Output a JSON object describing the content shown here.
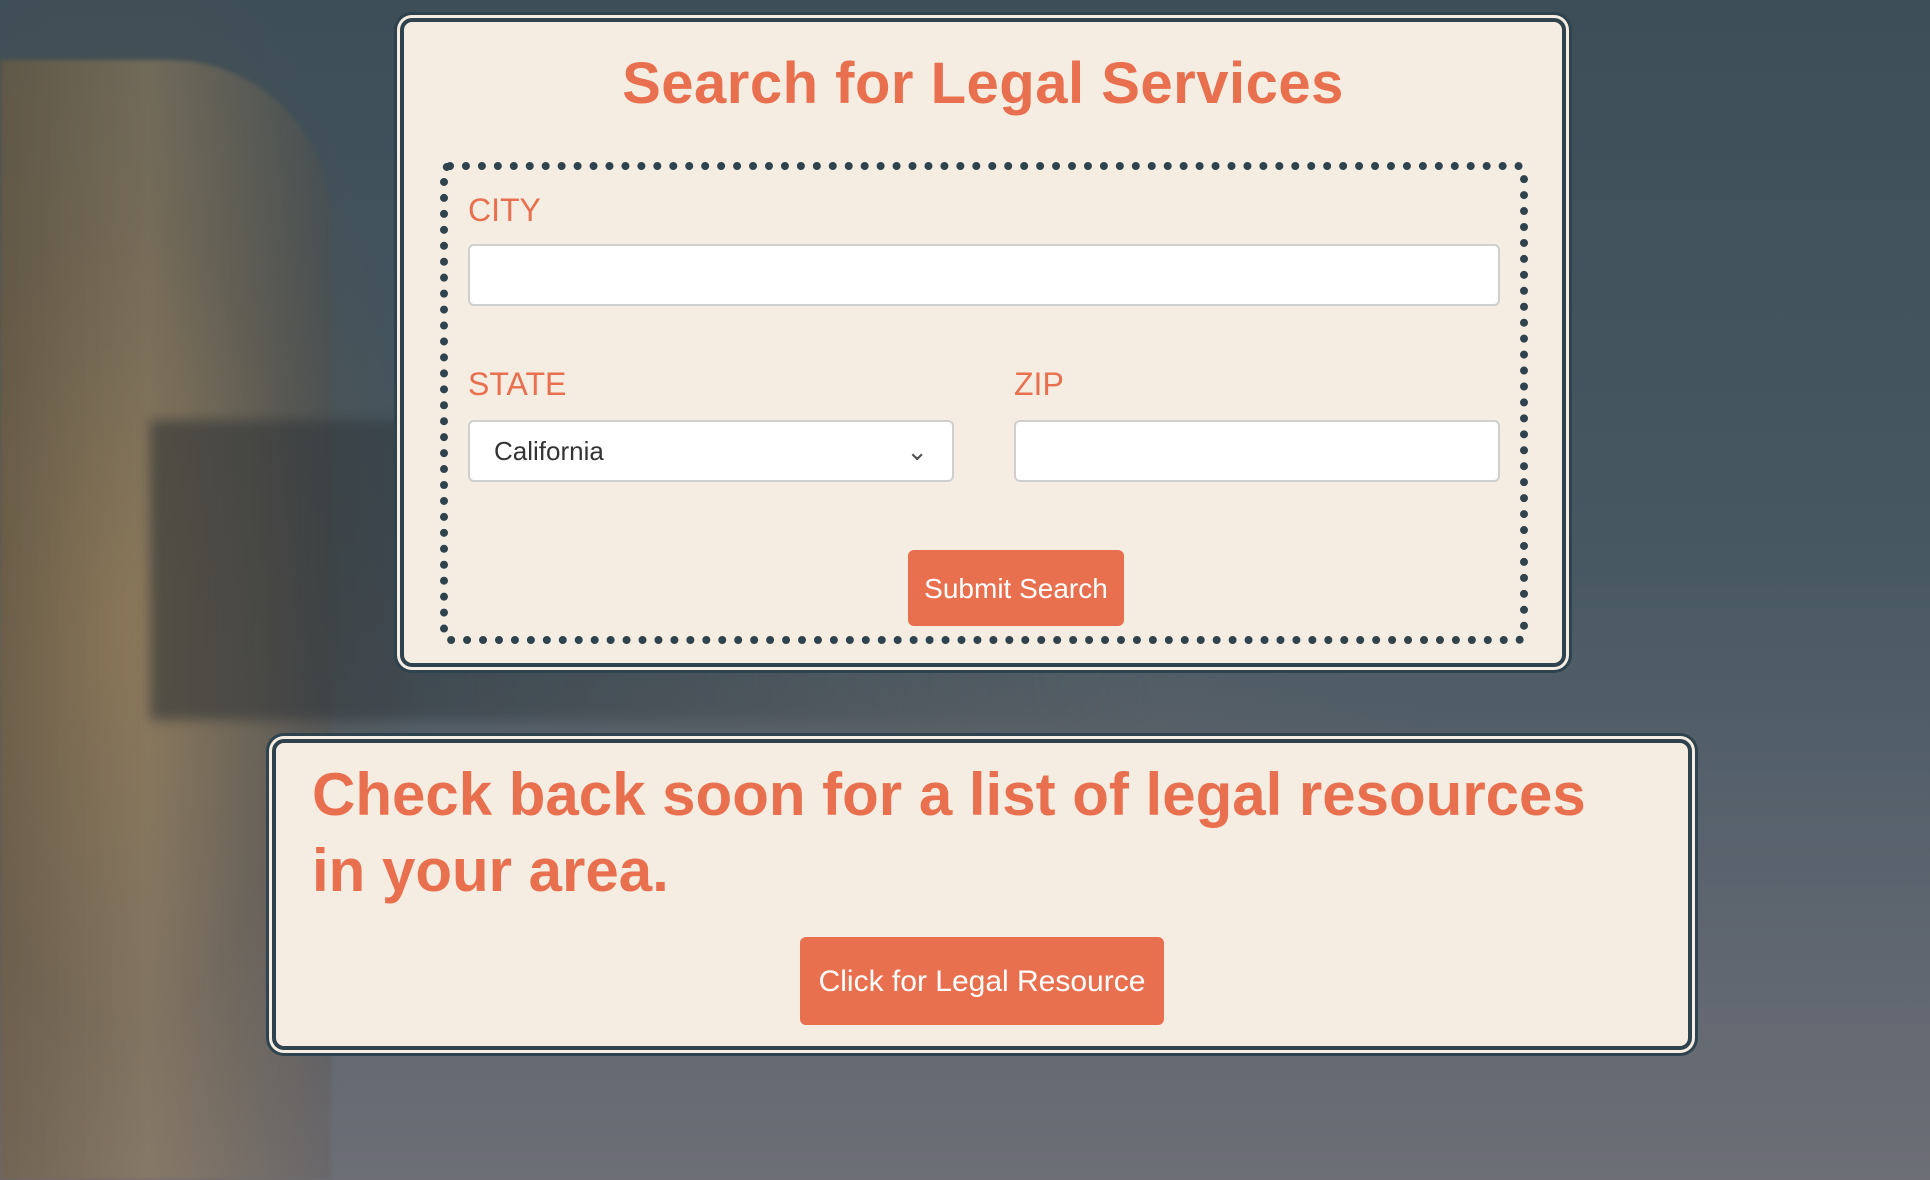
{
  "search_form": {
    "title": "Search for Legal Services",
    "city": {
      "label": "CITY",
      "value": "",
      "placeholder": ""
    },
    "state": {
      "label": "STATE",
      "selected": "California",
      "chevron_icon": "chevron-down-icon"
    },
    "zip": {
      "label": "ZIP",
      "value": "",
      "placeholder": ""
    },
    "submit_label": "Submit Search"
  },
  "resources": {
    "heading": "Check back soon for a list of legal resources in your area.",
    "button_label": "Click for Legal Resource"
  },
  "colors": {
    "accent": "#e8704f",
    "card_background": "#f5ece2",
    "border": "#2e434d"
  }
}
